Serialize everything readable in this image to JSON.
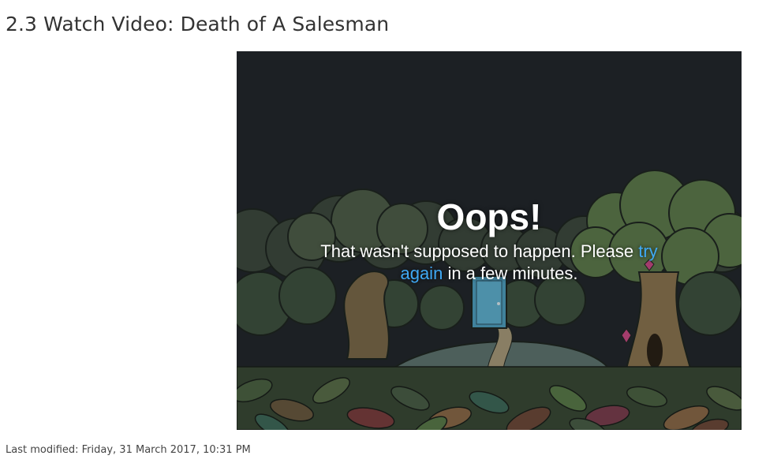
{
  "page": {
    "title": "2.3 Watch Video: Death of A Salesman",
    "last_modified": "Last modified: Friday, 31 March 2017, 10:31 PM"
  },
  "video": {
    "error_heading": "Oops!",
    "error_message_before": "That wasn't supposed to happen. Please",
    "retry_link": "try again",
    "error_message_after": "in a few minutes.",
    "illustration": "forest-clearing-with-blue-door",
    "colors": {
      "sky": "#23282d",
      "link": "#3fa9f5",
      "door": "#4f9fbf"
    }
  }
}
